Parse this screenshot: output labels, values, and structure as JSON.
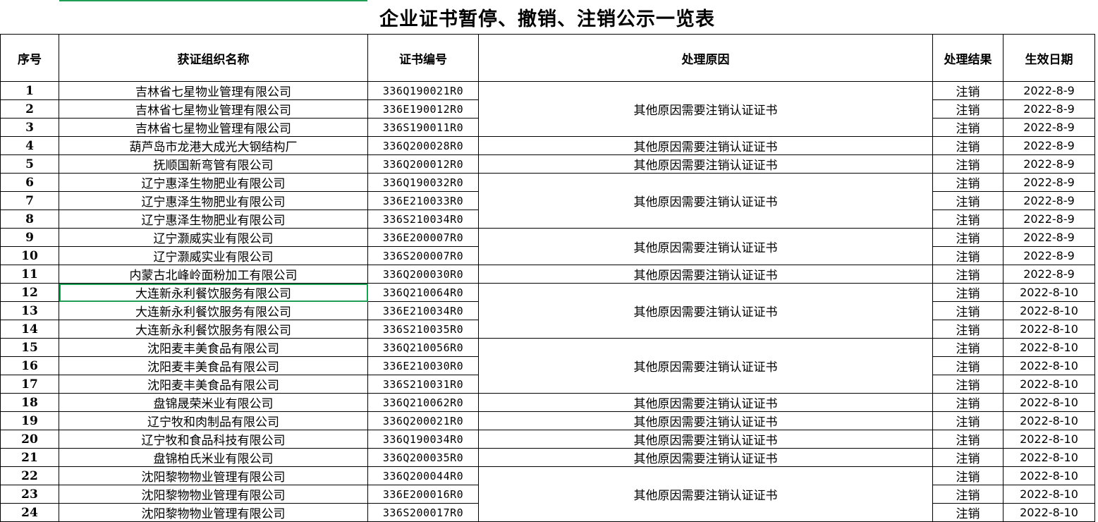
{
  "title": "企业证书暂停、撤销、注销公示一览表",
  "headers": [
    "序号",
    "获证组织名称",
    "证书编号",
    "处理原因",
    "处理结果",
    "生效日期"
  ],
  "reason_text": "其他原因需要注销认证证书",
  "accent_color": "#1f9d55",
  "rows": [
    {
      "no": "1",
      "org": "吉林省七星物业管理有限公司",
      "cert": "336Q190021R0",
      "result": "注销",
      "date": "2022-8-9"
    },
    {
      "no": "2",
      "org": "吉林省七星物业管理有限公司",
      "cert": "336E190012R0",
      "result": "注销",
      "date": "2022-8-9"
    },
    {
      "no": "3",
      "org": "吉林省七星物业管理有限公司",
      "cert": "336S190011R0",
      "result": "注销",
      "date": "2022-8-9"
    },
    {
      "no": "4",
      "org": "葫芦岛市龙港大成光大钢结构厂",
      "cert": "336Q200028R0",
      "result": "注销",
      "date": "2022-8-9"
    },
    {
      "no": "5",
      "org": "抚顺国新弯管有限公司",
      "cert": "336Q200012R0",
      "result": "注销",
      "date": "2022-8-9"
    },
    {
      "no": "6",
      "org": "辽宁惠泽生物肥业有限公司",
      "cert": "336Q190032R0",
      "result": "注销",
      "date": "2022-8-9"
    },
    {
      "no": "7",
      "org": "辽宁惠泽生物肥业有限公司",
      "cert": "336E210033R0",
      "result": "注销",
      "date": "2022-8-9"
    },
    {
      "no": "8",
      "org": "辽宁惠泽生物肥业有限公司",
      "cert": "336S210034R0",
      "result": "注销",
      "date": "2022-8-9"
    },
    {
      "no": "9",
      "org": "辽宁灏威实业有限公司",
      "cert": "336E200007R0",
      "result": "注销",
      "date": "2022-8-9"
    },
    {
      "no": "10",
      "org": "辽宁灏威实业有限公司",
      "cert": "336S200007R0",
      "result": "注销",
      "date": "2022-8-9"
    },
    {
      "no": "11",
      "org": "内蒙古北峰岭面粉加工有限公司",
      "cert": "336Q200030R0",
      "result": "注销",
      "date": "2022-8-9"
    },
    {
      "no": "12",
      "org": "大连新永利餐饮服务有限公司",
      "cert": "336Q210064R0",
      "result": "注销",
      "date": "2022-8-10"
    },
    {
      "no": "13",
      "org": "大连新永利餐饮服务有限公司",
      "cert": "336E210034R0",
      "result": "注销",
      "date": "2022-8-10"
    },
    {
      "no": "14",
      "org": "大连新永利餐饮服务有限公司",
      "cert": "336S210035R0",
      "result": "注销",
      "date": "2022-8-10"
    },
    {
      "no": "15",
      "org": "沈阳麦丰美食品有限公司",
      "cert": "336Q210056R0",
      "result": "注销",
      "date": "2022-8-10"
    },
    {
      "no": "16",
      "org": "沈阳麦丰美食品有限公司",
      "cert": "336E210030R0",
      "result": "注销",
      "date": "2022-8-10"
    },
    {
      "no": "17",
      "org": "沈阳麦丰美食品有限公司",
      "cert": "336S210031R0",
      "result": "注销",
      "date": "2022-8-10"
    },
    {
      "no": "18",
      "org": "盘锦晟荣米业有限公司",
      "cert": "336Q210062R0",
      "result": "注销",
      "date": "2022-8-10"
    },
    {
      "no": "19",
      "org": "辽宁牧和肉制品有限公司",
      "cert": "336Q200021R0",
      "result": "注销",
      "date": "2022-8-10"
    },
    {
      "no": "20",
      "org": "辽宁牧和食品科技有限公司",
      "cert": "336Q190034R0",
      "result": "注销",
      "date": "2022-8-10"
    },
    {
      "no": "21",
      "org": "盘锦柏氏米业有限公司",
      "cert": "336Q200035R0",
      "result": "注销",
      "date": "2022-8-10"
    },
    {
      "no": "22",
      "org": "沈阳黎物物业管理有限公司",
      "cert": "336Q200044R0",
      "result": "注销",
      "date": "2022-8-10"
    },
    {
      "no": "23",
      "org": "沈阳黎物物业管理有限公司",
      "cert": "336E200016R0",
      "result": "注销",
      "date": "2022-8-10"
    },
    {
      "no": "24",
      "org": "沈阳黎物物业管理有限公司",
      "cert": "336S200017R0",
      "result": "注销",
      "date": "2022-8-10"
    }
  ],
  "reason_groups": [
    3,
    1,
    1,
    3,
    2,
    1,
    3,
    3,
    1,
    1,
    1,
    1,
    3
  ],
  "chart_data": {
    "type": "table",
    "title": "企业证书暂停、撤销、注销公示一览表",
    "columns": [
      "序号",
      "获证组织名称",
      "证书编号",
      "处理原因",
      "处理结果",
      "生效日期"
    ]
  }
}
